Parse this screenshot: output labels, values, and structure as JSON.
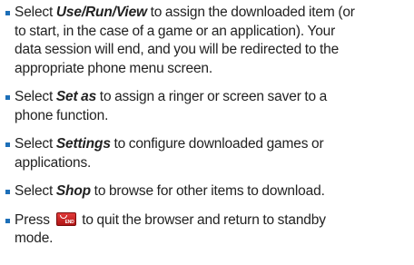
{
  "items": [
    {
      "label": "Use/Run/View",
      "lines": [
        "Select ",
        " to assign the downloaded item (or",
        "to start, in the case of a game or an application). Your",
        "data session will end, and you will be redirected to the",
        "appropriate phone menu screen."
      ]
    },
    {
      "label": "Set as",
      "lines": [
        "Select ",
        " to assign a ringer or screen saver to a",
        "phone function."
      ]
    },
    {
      "label": "Settings",
      "lines": [
        "Select ",
        " to configure downloaded games or",
        "applications."
      ]
    },
    {
      "label": "Shop",
      "lines": [
        "Select ",
        " to browse for other items to download."
      ]
    },
    {
      "end_key_icon": "end-key-icon",
      "end_key_text": "END",
      "lines": [
        "Press ",
        " to quit the browser and return to standby",
        "mode."
      ]
    }
  ],
  "colors": {
    "bullet": "#1d6fb8",
    "text": "#222222",
    "end_key": "#c82020"
  }
}
